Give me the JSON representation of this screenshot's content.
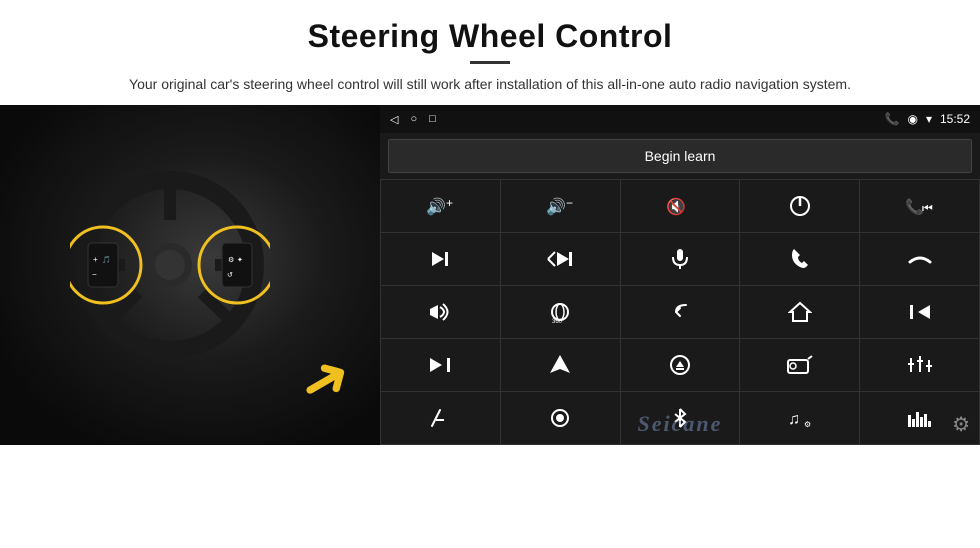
{
  "header": {
    "title": "Steering Wheel Control",
    "subtitle": "Your original car's steering wheel control will still work after installation of this all-in-one auto radio navigation system."
  },
  "statusbar": {
    "nav_back": "◁",
    "nav_home": "○",
    "nav_square": "□",
    "signal": "▪▪▮",
    "phone": "📞",
    "location": "◉",
    "wifi": "▾",
    "time": "15:52"
  },
  "begin_learn": {
    "button_label": "Begin learn"
  },
  "controls": [
    {
      "icon": "🔊+",
      "label": "vol-up"
    },
    {
      "icon": "🔊−",
      "label": "vol-down"
    },
    {
      "icon": "🔇",
      "label": "mute"
    },
    {
      "icon": "⏻",
      "label": "power"
    },
    {
      "icon": "⏮",
      "label": "prev-track-phone"
    },
    {
      "icon": "⏭",
      "label": "next"
    },
    {
      "icon": "⏩",
      "label": "fast-forward"
    },
    {
      "icon": "🎤",
      "label": "mic"
    },
    {
      "icon": "📞",
      "label": "call"
    },
    {
      "icon": "↩",
      "label": "hangup"
    },
    {
      "icon": "📢",
      "label": "horn"
    },
    {
      "icon": "360°",
      "label": "camera-360"
    },
    {
      "icon": "↺",
      "label": "back"
    },
    {
      "icon": "⌂",
      "label": "home"
    },
    {
      "icon": "⏮⏮",
      "label": "prev-track"
    },
    {
      "icon": "⏭",
      "label": "skip"
    },
    {
      "icon": "▶",
      "label": "navigate"
    },
    {
      "icon": "⏺",
      "label": "eject"
    },
    {
      "icon": "📻",
      "label": "radio"
    },
    {
      "icon": "⚙",
      "label": "eq"
    },
    {
      "icon": "🎤",
      "label": "mic2"
    },
    {
      "icon": "⏺",
      "label": "dot"
    },
    {
      "icon": "✱",
      "label": "bluetooth"
    },
    {
      "icon": "🎵",
      "label": "music"
    },
    {
      "icon": "📊",
      "label": "equalizer"
    }
  ],
  "watermark": {
    "text": "Seicane"
  }
}
